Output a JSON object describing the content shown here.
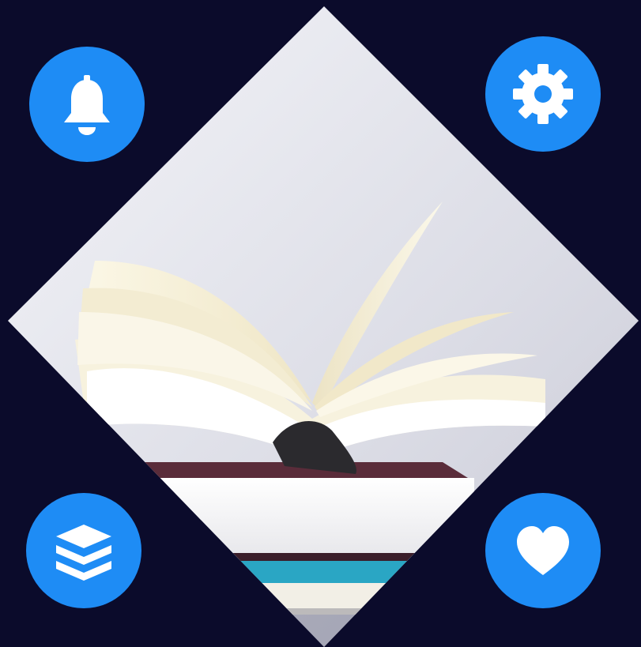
{
  "colors": {
    "background": "#0b0b2b",
    "accent": "#1e8cf5",
    "icon": "#ffffff"
  },
  "image": {
    "subject": "open-book-on-stack-icon"
  },
  "buttons": [
    {
      "icon": "bell-icon"
    },
    {
      "icon": "gear-icon"
    },
    {
      "icon": "layers-icon"
    },
    {
      "icon": "heart-icon"
    }
  ]
}
